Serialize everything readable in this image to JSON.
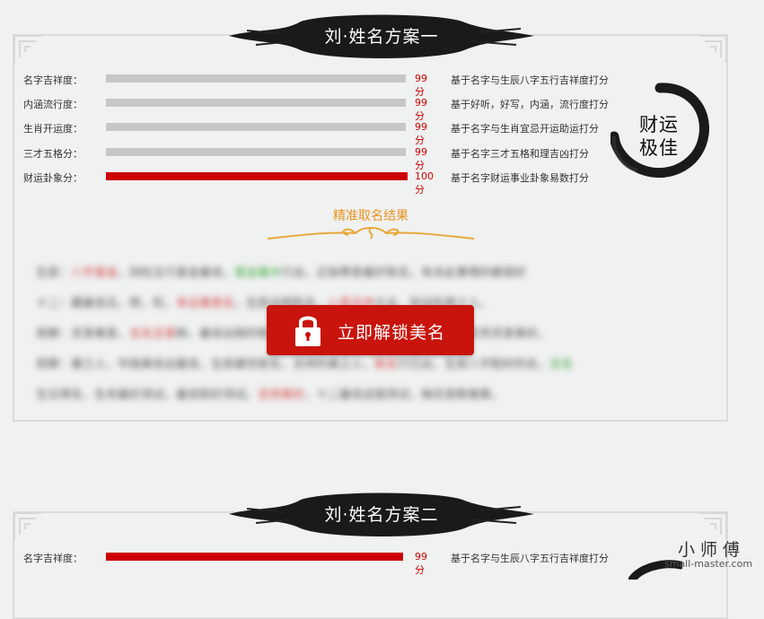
{
  "plan1": {
    "title": "刘·姓名方案一",
    "rows": [
      {
        "label": "名字吉祥度：",
        "score": "99分",
        "desc": "基于名字与生辰八字五行吉祥度打分",
        "level": 0.99,
        "highlight": false
      },
      {
        "label": "内涵流行度：",
        "score": "99分",
        "desc": "基于好听，好写，内涵，流行度打分",
        "level": 0.99,
        "highlight": false
      },
      {
        "label": "生肖开运度：",
        "score": "99分",
        "desc": "基于名字与生肖宜忌开运助运打分",
        "level": 0.99,
        "highlight": false
      },
      {
        "label": "三才五格分：",
        "score": "99分",
        "desc": "基于名字三才五格和理吉凶打分",
        "level": 0.99,
        "highlight": false
      },
      {
        "label": "财运卦象分：",
        "score": "100分",
        "desc": "基于名字财运事业卦象易数打分",
        "level": 1.0,
        "highlight": true
      }
    ],
    "seal_line1": "财运",
    "seal_line2": "极佳",
    "result_title": "精准取名结果",
    "unlock_label": "立即解锁美名"
  },
  "plan2": {
    "title": "刘·姓名方案二",
    "rows": [
      {
        "label": "名字吉祥度：",
        "score": "99分",
        "desc": "基于名字与生辰八字五行吉祥度打分",
        "level": 0.99,
        "highlight": true
      }
    ]
  },
  "watermark": {
    "brand": "小师傅",
    "url": "small-master.com"
  },
  "colors": {
    "accent_red": "#cc0000",
    "button_red": "#c8140c",
    "gold": "#e8931e",
    "bar_gray": "#c7c7c7"
  }
}
